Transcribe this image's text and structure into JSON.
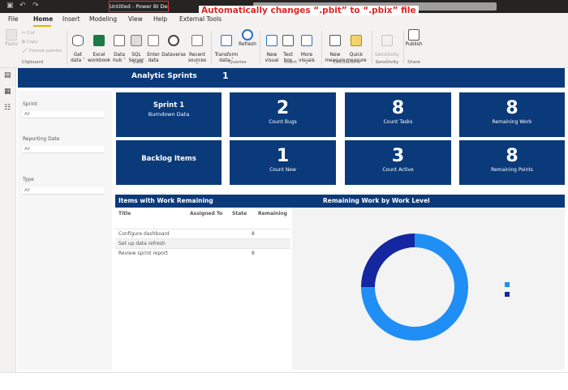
{
  "window": {
    "title": "Untitled - Power BI Desktop",
    "annotation": "Automatically changes “.pbit” to “.pbix” file"
  },
  "menu": {
    "tabs": [
      {
        "label": "File"
      },
      {
        "label": "Home"
      },
      {
        "label": "Insert"
      },
      {
        "label": "Modeling"
      },
      {
        "label": "View"
      },
      {
        "label": "Help"
      },
      {
        "label": "External Tools"
      }
    ]
  },
  "ribbon": {
    "clipboard": {
      "paste": "Paste",
      "cut": "Cut",
      "copy": "Copy",
      "format_painter": "Format painter",
      "group": "Clipboard"
    },
    "data": {
      "get_data": "Get\ndata ˅",
      "excel": "Excel\nworkbook",
      "data_hub": "Data\nhub ˅",
      "sql": "SQL\nServer",
      "enter_data": "Enter\ndata",
      "dataverse": "Dataverse",
      "recent": "Recent\nsources ˅",
      "group": "Data"
    },
    "queries": {
      "transform": "Transform\ndata ˅",
      "refresh": "Refresh",
      "group": "Queries"
    },
    "insert": {
      "new_visual": "New\nvisual",
      "text_box": "Text\nbox",
      "more_visuals": "More\nvisuals ˅",
      "group": "Insert"
    },
    "calculations": {
      "new_measure": "New\nmeasure",
      "quick_measure": "Quick\nmeasure",
      "group": "Calculations"
    },
    "sensitivity": {
      "label": "Sensitivity\n˅",
      "group": "Sensitivity"
    },
    "share": {
      "publish": "Publish",
      "group": "Share"
    }
  },
  "report": {
    "header": {
      "title": "Analytic Sprints",
      "value": "1"
    },
    "slicers": [
      {
        "label": "Sprint",
        "value": "All"
      },
      {
        "label": "Reporting Date",
        "value": "All"
      },
      {
        "label": "Type",
        "value": "All"
      }
    ],
    "cards": [
      {
        "title": "Sprint 1",
        "subtitle": "Burndown Data"
      },
      {
        "value": "2",
        "label": "Count Bugs"
      },
      {
        "value": "8",
        "label": "Count Tasks"
      },
      {
        "value": "8",
        "label": "Remaining Work"
      },
      {
        "title": "Backlog Items",
        "subtitle": ""
      },
      {
        "value": "1",
        "label": "Count New"
      },
      {
        "value": "3",
        "label": "Count Active"
      },
      {
        "value": "8",
        "label": "Remaining Points"
      }
    ],
    "table_section_title": "Items with Work Remaining",
    "chart_section_title": "Remaining Work by Work Level",
    "table": {
      "headers": [
        "Title",
        "Assigned To",
        "State",
        "Remaining"
      ],
      "rows": [
        {
          "title": "Configure dashboard",
          "assigned": "",
          "state": "",
          "remaining": "8"
        },
        {
          "title": "Set up data refresh",
          "assigned": "",
          "state": "",
          "remaining": ""
        },
        {
          "title": "Review sprint report",
          "assigned": "",
          "state": "",
          "remaining": "8"
        }
      ]
    }
  },
  "chart_data": {
    "type": "pie",
    "donut": true,
    "title": "Remaining Work by Work Level",
    "series": [
      {
        "name": "",
        "value": 75,
        "color": "#1f8ef5"
      },
      {
        "name": "",
        "value": 25,
        "color": "#1426a0"
      }
    ],
    "legend": {
      "title": "",
      "items": [
        "",
        ""
      ],
      "position": "right"
    },
    "outer_label": "",
    "outer_label_bottom": ""
  }
}
